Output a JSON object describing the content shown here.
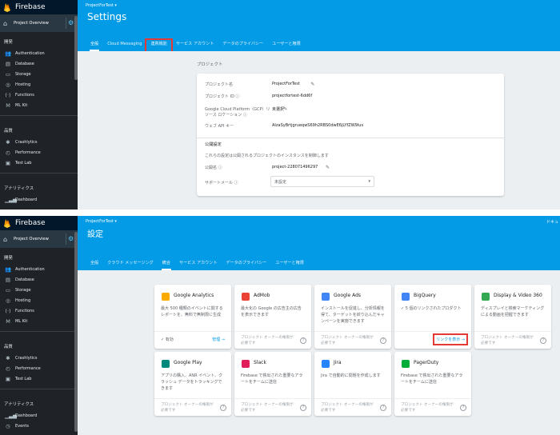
{
  "brand": "Firebase",
  "colors": {
    "accent": "#039be5",
    "sidebar": "#1f2328",
    "highlight": "#e53935"
  },
  "shot1": {
    "sidebar": {
      "project": "Project Overview",
      "sections": [
        {
          "title": "開発",
          "items": [
            {
              "icon": "people-icon",
              "glyph": "👥",
              "label": "Authentication"
            },
            {
              "icon": "database-icon",
              "glyph": "▤",
              "label": "Database"
            },
            {
              "icon": "storage-icon",
              "glyph": "▭",
              "label": "Storage"
            },
            {
              "icon": "hosting-icon",
              "glyph": "◎",
              "label": "Hosting"
            },
            {
              "icon": "functions-icon",
              "glyph": "(·)",
              "label": "Functions"
            },
            {
              "icon": "mlkit-icon",
              "glyph": "M",
              "label": "ML Kit"
            }
          ]
        },
        {
          "title": "品質",
          "items": [
            {
              "icon": "crashlytics-icon",
              "glyph": "✱",
              "label": "Crashlytics"
            },
            {
              "icon": "performance-icon",
              "glyph": "◴",
              "label": "Performance"
            },
            {
              "icon": "testlab-icon",
              "glyph": "▣",
              "label": "Test Lab"
            }
          ]
        },
        {
          "title": "アナリティクス",
          "items": [
            {
              "icon": "dashboard-icon",
              "glyph": "▁▃▅",
              "label": "Dashboard"
            }
          ]
        }
      ]
    },
    "header": {
      "project": "ProjectForTest ▾",
      "title": "Settings",
      "tabs": [
        "全般",
        "Cloud Messaging",
        "連携機能",
        "サービス アカウント",
        "データのプライバシー",
        "ユーザーと権限"
      ]
    },
    "content": {
      "section_label": "プロジェクト",
      "rows": [
        {
          "key": "プロジェクト名",
          "value": "ProjectForTest",
          "editable": true
        },
        {
          "key": "プロジェクト ID ⓘ",
          "value": "projectfortest-6dd6f",
          "editable": false
        },
        {
          "key": "Google Cloud Platform（GCP）リソース ロケーション ⓘ",
          "value": "未選択",
          "editable": true
        },
        {
          "key": "ウェブ API キー",
          "value": "AIzaSyBrtjgrueqwS69h2RBS0dwE6jLYfZW9Ius",
          "editable": false
        }
      ],
      "public_heading": "公開設定",
      "public_sub": "これらの設定は公開されるプロジェクトのインスタンスを制御します",
      "public_rows": [
        {
          "key": "公開名 ⓘ",
          "value": "project-228071496297",
          "editable": true
        }
      ],
      "support_email": {
        "key": "サポートメール ⓘ",
        "value": "未設定"
      }
    }
  },
  "shot2": {
    "sidebar": {
      "project": "Project Overview",
      "sections": [
        {
          "title": "開発",
          "items": [
            {
              "icon": "people-icon",
              "glyph": "👥",
              "label": "Authentication"
            },
            {
              "icon": "database-icon",
              "glyph": "▤",
              "label": "Database"
            },
            {
              "icon": "storage-icon",
              "glyph": "▭",
              "label": "Storage"
            },
            {
              "icon": "hosting-icon",
              "glyph": "◎",
              "label": "Hosting"
            },
            {
              "icon": "functions-icon",
              "glyph": "(·)",
              "label": "Functions"
            },
            {
              "icon": "mlkit-icon",
              "glyph": "M",
              "label": "ML Kit"
            }
          ]
        },
        {
          "title": "品質",
          "items": [
            {
              "icon": "crashlytics-icon",
              "glyph": "✱",
              "label": "Crashlytics"
            },
            {
              "icon": "performance-icon",
              "glyph": "◴",
              "label": "Performance"
            },
            {
              "icon": "testlab-icon",
              "glyph": "▣",
              "label": "Test Lab"
            }
          ]
        },
        {
          "title": "アナリティクス",
          "items": [
            {
              "icon": "dashboard-icon",
              "glyph": "▁▃▅",
              "label": "Dashboard"
            },
            {
              "icon": "events-icon",
              "glyph": "◷",
              "label": "Events"
            }
          ]
        }
      ]
    },
    "header": {
      "project": "ProjectForTest ▾",
      "right_text": "ドキュ",
      "title": "設定",
      "tabs": [
        "全般",
        "クラウド メッセージング",
        "統合",
        "サービス アカウント",
        "データのプライバシー",
        "ユーザーと権限"
      ]
    },
    "integrations": [
      {
        "name": "Google Analytics",
        "logo": "analytics-logo",
        "color": "#f9ab00",
        "desc": "最大 500 種類のイベントに関するレポートを、無料で無制限に生成",
        "status": "✓ 有効",
        "link": "管理 →",
        "note": ""
      },
      {
        "name": "AdMob",
        "logo": "admob-logo",
        "color": "#ea4335",
        "desc": "最大化の Google の広告主の広告を表示できます",
        "status": "",
        "link": "",
        "note": "プロジェクト オーナーの権限が必要です"
      },
      {
        "name": "Google Ads",
        "logo": "googleads-logo",
        "color": "#4285f4",
        "desc": "インストールを促進し、分析情報を得て、ターゲットを絞り込んだキャンペーンを実施できます",
        "status": "",
        "link": "",
        "note": "プロジェクト オーナーの権限が必要です"
      },
      {
        "name": "BigQuery",
        "logo": "bigquery-logo",
        "color": "#4285f4",
        "desc": "✓ 5 個のリンクされたプロダクト",
        "status": "",
        "link": "リンクを表示 →",
        "note": ""
      },
      {
        "name": "Display & Video 360",
        "logo": "dv360-logo",
        "color": "#34a853",
        "desc": "ディスプレイと検索マーケティングによる動画を把握できます",
        "status": "",
        "link": "",
        "note": "プロジェクト オーナーの権限が必要です"
      },
      {
        "name": "Google Play",
        "logo": "googleplay-logo",
        "color": "#00897b",
        "desc": "アプリの購入、ANR イベント、クラッシュ データをトラッキングできます",
        "status": "",
        "link": "",
        "note": "プロジェクト オーナーの権限が必要です"
      },
      {
        "name": "Slack",
        "logo": "slack-logo",
        "color": "#e01e5a",
        "desc": "Firebase で検出された重要なアラートをチームに送信",
        "status": "",
        "link": "",
        "note": "プロジェクト オーナーの権限が必要です"
      },
      {
        "name": "Jira",
        "logo": "jira-logo",
        "color": "#2684ff",
        "desc": "Jira で自動的に問題を作成します",
        "status": "",
        "link": "",
        "note": "プロジェクト オーナーの権限が必要です"
      },
      {
        "name": "PagerDuty",
        "logo": "pagerduty-logo",
        "color": "#06ac38",
        "desc": "Firebase で検出された重要なアラートをチームに送信",
        "status": "",
        "link": "",
        "note": "プロジェクト オーナーの権限が必要です"
      }
    ]
  }
}
